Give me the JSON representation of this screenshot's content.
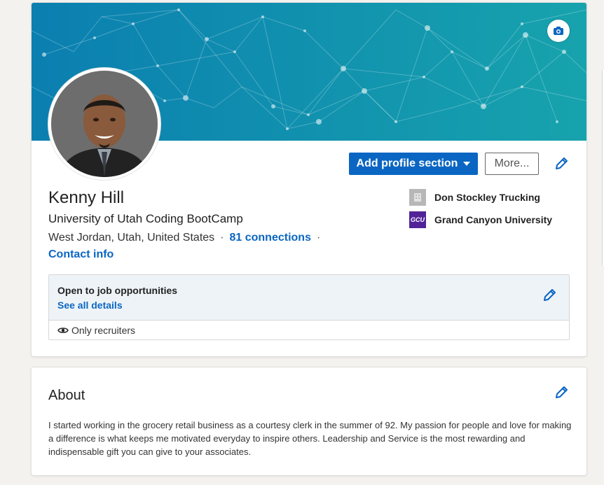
{
  "profile": {
    "name": "Kenny Hill",
    "headline": "University of Utah Coding BootCamp",
    "location": "West Jordan, Utah, United States",
    "separator": "·",
    "connections": "81 connections",
    "contact_info": "Contact info",
    "add_section_label": "Add profile section",
    "more_label": "More...",
    "companies": [
      {
        "name": "Don Stockley Trucking",
        "logo": "building-icon"
      },
      {
        "name": "Grand Canyon University",
        "logo_text": "GCU"
      }
    ],
    "open_to_work": {
      "title": "Open to job opportunities",
      "details_link": "See all details",
      "visibility": "Only recruiters"
    }
  },
  "about": {
    "title": "About",
    "text": "I started working in the grocery retail business as a courtesy clerk in the summer of 92. My passion for people and love for making a difference is what keeps me motivated everyday to inspire others. Leadership and Service is the most rewarding and indispensable gift you can give to your associates."
  },
  "colors": {
    "brand_blue": "#0a66c2",
    "banner_start": "#0b7fb0",
    "banner_end": "#1aa7b0",
    "gcu_purple": "#522398"
  }
}
